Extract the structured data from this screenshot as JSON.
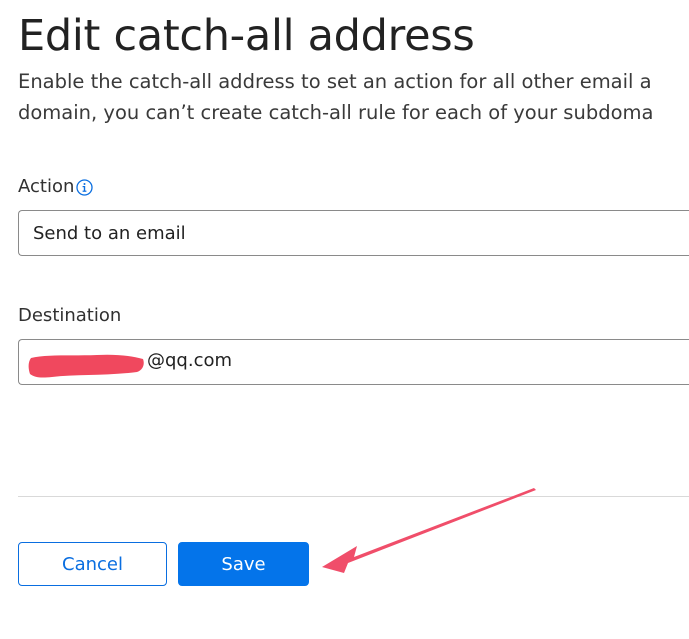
{
  "header": {
    "title": "Edit catch-all address",
    "description_line1": "Enable the catch-all address to set an action for all other email a",
    "description_line2": "domain, you can’t create catch-all rule for each of your subdoma"
  },
  "form": {
    "action": {
      "label": "Action",
      "info_icon": "info-icon",
      "value": "Send to an email"
    },
    "destination": {
      "label": "Destination",
      "value_visible": "@qq.com",
      "redacted": true
    }
  },
  "buttons": {
    "cancel_label": "Cancel",
    "save_label": "Save"
  },
  "annotation": {
    "icon": "arrow-annotation",
    "color": "#f04e6a"
  },
  "colors": {
    "accent": "#0474ea",
    "redaction": "#f0485e"
  }
}
